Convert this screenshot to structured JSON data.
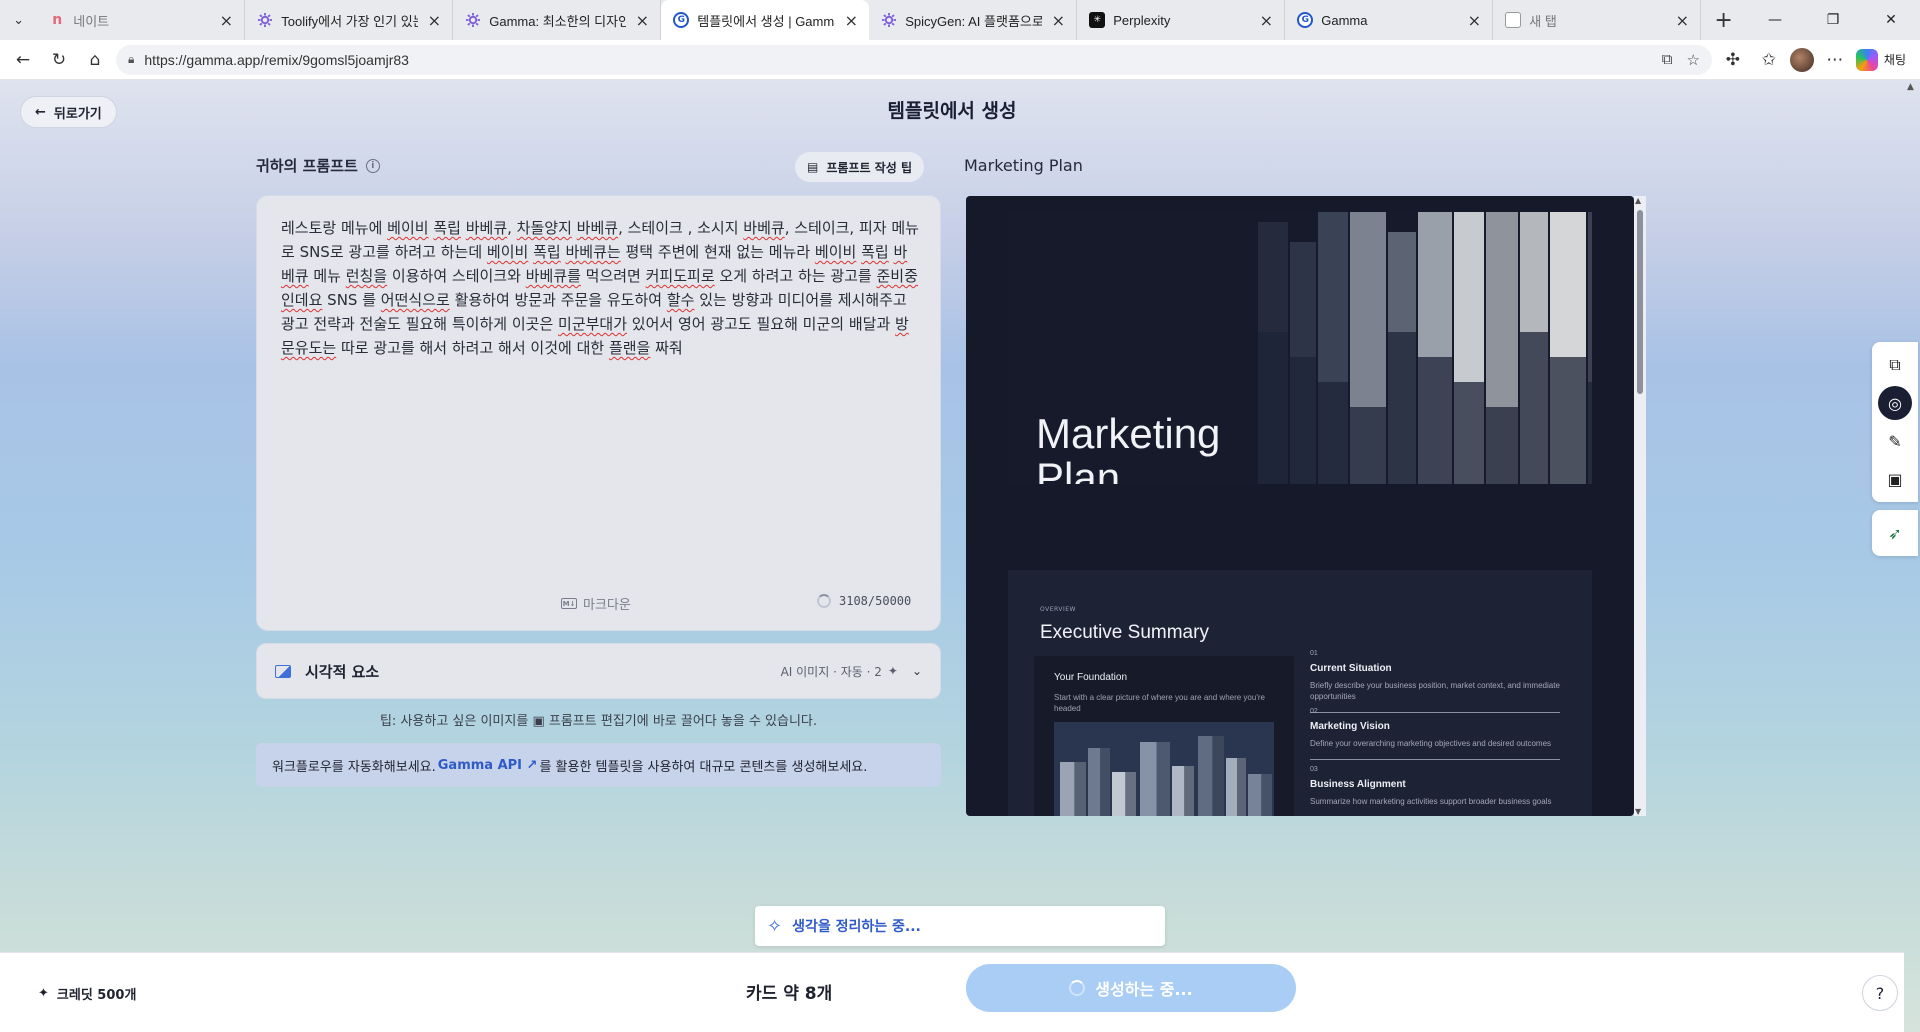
{
  "browser": {
    "tabs": [
      {
        "title": "네이트",
        "icon": "notion-icon",
        "faded": true
      },
      {
        "title": "Toolify에서 가장 인기 있는 A",
        "icon": "toolify-icon"
      },
      {
        "title": "Gamma: 최소한의 디자인 노",
        "icon": "toolify-icon"
      },
      {
        "title": "템플릿에서 생성 | Gamma",
        "icon": "gamma-icon",
        "active": true
      },
      {
        "title": "SpicyGen: AI 플랫폼으로 이미",
        "icon": "toolify-icon"
      },
      {
        "title": "Perplexity",
        "icon": "perplexity-icon"
      },
      {
        "title": "Gamma",
        "icon": "gamma-icon"
      },
      {
        "title": "새 탭",
        "icon": "new-tab-icon",
        "faded": true
      }
    ],
    "url": "https://gamma.app/remix/9gomsl5joamjr83",
    "copilot_label": "채팅"
  },
  "header": {
    "back_label": "뒤로가기",
    "title": "템플릿에서 생성"
  },
  "prompt": {
    "label": "귀하의 프롬프트",
    "tips_label": "프롬프트 작성 팁",
    "text_parts": [
      {
        "t": "레스토랑 메뉴에 "
      },
      {
        "t": "베이비",
        "s": true
      },
      {
        "t": " "
      },
      {
        "t": "폭립",
        "s": true
      },
      {
        "t": " "
      },
      {
        "t": "바베큐",
        "s": true
      },
      {
        "t": ", "
      },
      {
        "t": "차돌양지",
        "s": true
      },
      {
        "t": " "
      },
      {
        "t": "바베큐",
        "s": true
      },
      {
        "t": ", 스테이크 , 소시지 "
      },
      {
        "t": "바베큐",
        "s": true
      },
      {
        "t": ", 스테이크, 피자 메뉴로 SNS로 광고를 하려고 하는데 "
      },
      {
        "t": "베이비",
        "s": true
      },
      {
        "t": " "
      },
      {
        "t": "폭립",
        "s": true
      },
      {
        "t": " "
      },
      {
        "t": "바베큐는",
        "s": true
      },
      {
        "t": " 평택 주변에 현재 없는 메뉴라 "
      },
      {
        "t": "베이비",
        "s": true
      },
      {
        "t": " "
      },
      {
        "t": "폭립",
        "s": true
      },
      {
        "t": " "
      },
      {
        "t": "바베큐",
        "s": true
      },
      {
        "t": " 메뉴 "
      },
      {
        "t": "런칭을",
        "s": true
      },
      {
        "t": " 이용하여 스테이크와 "
      },
      {
        "t": "바베큐를",
        "s": true
      },
      {
        "t": " 먹으려면 "
      },
      {
        "t": "커피도피로",
        "s": true
      },
      {
        "t": " 오게 하려고 하는 광고를 "
      },
      {
        "t": "준비중인데요",
        "s": true
      },
      {
        "t": " SNS 를 "
      },
      {
        "t": "어떤식으로",
        "s": true
      },
      {
        "t": " 활용하여 방문과 주문을 유도하여 "
      },
      {
        "t": "할수",
        "s": true
      },
      {
        "t": " 있는 방향과 미디어를 제시해주고 광고 전략과 전술도 필요해 특이하게 이곳은 "
      },
      {
        "t": "미군부대가",
        "s": true
      },
      {
        "t": " 있어서 영어 광고도 필요해 미군의 배달과 "
      },
      {
        "t": "방문유도는",
        "s": true
      },
      {
        "t": " 따로 광고를 해서 하려고 해서 이것에 대한 "
      },
      {
        "t": "플랜을",
        "s": true
      },
      {
        "t": " 짜줘"
      }
    ],
    "markdown_label": "마크다운",
    "char_count": "3108/50000"
  },
  "visual": {
    "title": "시각적 요소",
    "meta": "AI 이미지 · 자동 · 2"
  },
  "tip": {
    "before": "팁: 사용하고 싶은 이미지를 ",
    "after": " 프롬프트 편집기에 바로 끌어다 놓을 수 있습니다."
  },
  "api_banner": {
    "before": "워크플로우를 자동화해보세요.",
    "link": "Gamma API",
    "after": "를 활용한 템플릿을 사용하여 대규모 콘텐츠를 생성해보세요."
  },
  "preview": {
    "label": "Marketing Plan",
    "slide1_title_line1": "Marketing",
    "slide1_title_line2": "Plan",
    "slide2": {
      "overline": "OVERVIEW",
      "title": "Executive Summary",
      "card_title": "Your Foundation",
      "card_text": "Start with a clear picture of where you are and where you're headed",
      "items": [
        {
          "num": "01",
          "title": "Current Situation",
          "text": "Briefly describe your business position, market context, and immediate opportunities"
        },
        {
          "num": "02",
          "title": "Marketing Vision",
          "text": "Define your overarching marketing objectives and desired outcomes"
        },
        {
          "num": "03",
          "title": "Business Alignment",
          "text": "Summarize how marketing activities support broader business goals"
        }
      ]
    }
  },
  "status": {
    "thinking": "생각을 정리하는 중..."
  },
  "footer": {
    "credits": "크레딧 500개",
    "cards": "카드 약 8개",
    "generate": "생성하는 중...",
    "help": "?"
  }
}
